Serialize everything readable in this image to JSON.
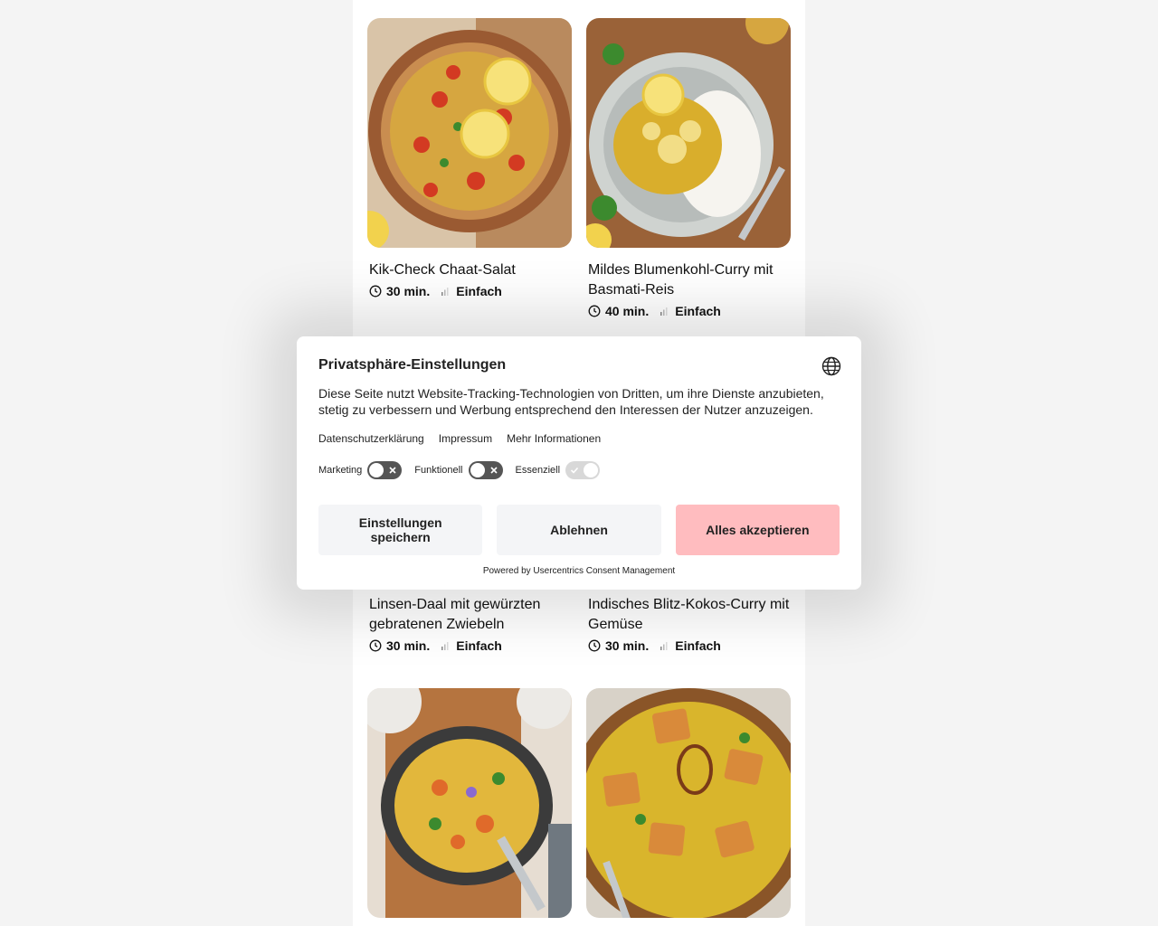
{
  "recipes": [
    {
      "title": "Kik-Check Chaat-Salat",
      "time": "30 min.",
      "difficulty": "Einfach"
    },
    {
      "title": "Mildes Blumenkohl-Curry mit Basmati-Reis",
      "time": "40 min.",
      "difficulty": "Einfach"
    },
    {
      "title": "Linsen-Daal mit gewürzten gebratenen Zwiebeln",
      "time": "30 min.",
      "difficulty": "Einfach"
    },
    {
      "title": "Indisches Blitz-Kokos-Curry mit Gemüse",
      "time": "30 min.",
      "difficulty": "Einfach"
    },
    {
      "title": "",
      "time": "",
      "difficulty": ""
    },
    {
      "title": "",
      "time": "",
      "difficulty": ""
    }
  ],
  "consent": {
    "title": "Privatsphäre-Einstellungen",
    "text": "Diese Seite nutzt Website-Tracking-Technologien von Dritten, um ihre Dienste anzubieten, stetig zu verbessern und Werbung entsprechend den Interessen der Nutzer anzuzeigen.",
    "links": [
      "Datenschutzerklärung",
      "Impressum",
      "Mehr Informationen"
    ],
    "toggles": [
      {
        "label": "Marketing",
        "state": "off"
      },
      {
        "label": "Funktionell",
        "state": "off"
      },
      {
        "label": "Essenziell",
        "state": "locked-on"
      }
    ],
    "buttons": {
      "save": "Einstellungen speichern",
      "deny": "Ablehnen",
      "accept": "Alles akzeptieren"
    },
    "powered_by": "Powered by Usercentrics Consent Management"
  },
  "colors": {
    "accept_button": "#ffbcbf",
    "secondary_button": "#f4f5f7",
    "toggle_off": "#555555",
    "page_background": "#f4f4f4"
  }
}
